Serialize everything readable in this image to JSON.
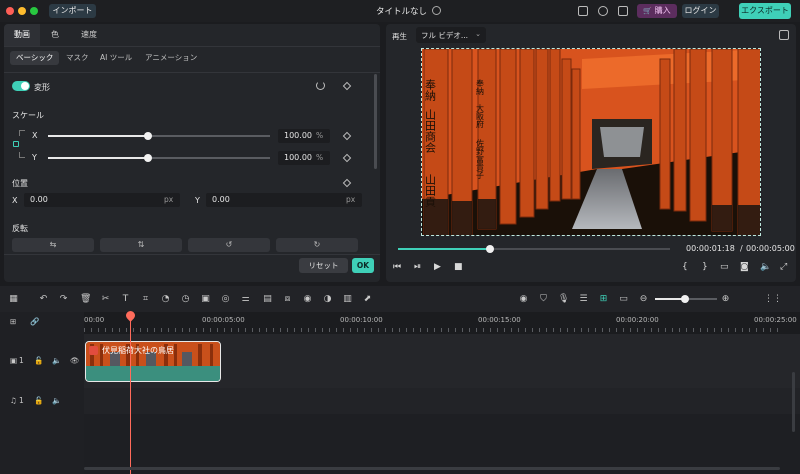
{
  "titlebar": {
    "import_label": "インポート",
    "title": "タイトルなし",
    "purchase_label": "購入",
    "login_label": "ログイン",
    "export_label": "エクスポート"
  },
  "left_panel": {
    "tabs": [
      "動画",
      "色",
      "速度"
    ],
    "subtabs": [
      "ベーシック",
      "マスク",
      "AI ツール",
      "アニメーション"
    ],
    "transform_label": "変形",
    "scale_label": "スケール",
    "scale_x_label": "X",
    "scale_y_label": "Y",
    "scale_x_value": "100.00",
    "scale_y_value": "100.00",
    "percent_unit": "%",
    "scale_x_level": 0.45,
    "scale_y_level": 0.45,
    "position_label": "位置",
    "pos_x_label": "X",
    "pos_y_label": "Y",
    "pos_x_value": "0.00",
    "pos_y_value": "0.00",
    "px_unit": "px",
    "flip_label": "反転",
    "reset_label": "リセット",
    "ok_label": "OK"
  },
  "preview": {
    "play_label": "再生",
    "quality_value": "フル ビデオ...",
    "current_time": "00:00:01:18",
    "separator": "/",
    "total_time": "00:00:05:00",
    "progress": 0.34,
    "image_text": {
      "pillar_left_1": "奉納",
      "pillar_left_2": "山田商会",
      "pillar_left_3": "山田貢",
      "pillar_mid_1": "奉納",
      "pillar_mid_2": "大阪府",
      "pillar_mid_3": "佐野富貴子"
    }
  },
  "timeline": {
    "ruler_labels": [
      "00:00",
      "00:00:05:00",
      "00:00:10:00",
      "00:00:15:00",
      "00:00:20:00",
      "00:00:25:00"
    ],
    "video_track_num": "1",
    "audio_track_num": "1",
    "clip_title": "伏見稲荷大社の鳥居",
    "zoom_level": 0.48
  },
  "colors": {
    "accent": "#3fd0b8",
    "playhead": "#ff6b5b",
    "purchase": "#5c2d5e"
  }
}
